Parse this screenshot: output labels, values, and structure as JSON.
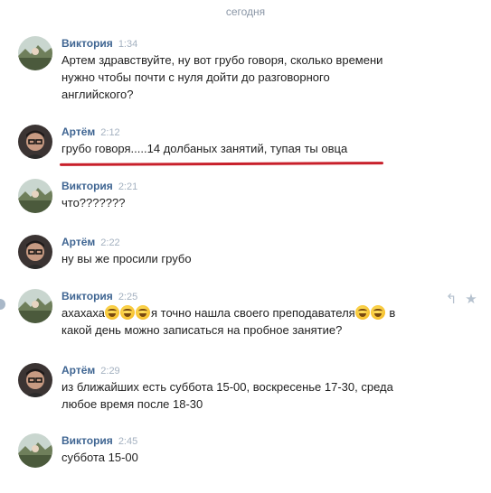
{
  "date_separator": "сегодня",
  "messages": [
    {
      "author": "Виктория",
      "time": "1:34",
      "lines": [
        "Артем здравствуйте, ну вот грубо говоря, сколько времени",
        "нужно чтобы почти с нуля дойти до разговорного",
        "английского?"
      ]
    },
    {
      "author": "Артём",
      "time": "2:12",
      "lines": [
        "грубо говоря.....14 долбаных занятий, тупая ты овца"
      ]
    },
    {
      "author": "Виктория",
      "time": "2:21",
      "lines": [
        "что???????"
      ]
    },
    {
      "author": "Артём",
      "time": "2:22",
      "lines": [
        "ну вы же просили грубо"
      ]
    },
    {
      "author": "Виктория",
      "time": "2:25",
      "line1_a": "ахахаха",
      "line1_b": "я точно нашла своего преподавателя",
      "line1_c": " в",
      "line2": "какой день можно записаться на пробное занятие?",
      "emoji_icon": "laughing-face-emoji"
    },
    {
      "author": "Артём",
      "time": "2:29",
      "lines": [
        "из ближайших есть суббота 15-00, воскресенье 17-30, среда",
        "любое время после 18-30"
      ]
    },
    {
      "author": "Виктория",
      "time": "2:45",
      "lines": [
        "суббота 15-00"
      ]
    }
  ],
  "actions": {
    "reply_icon": "↰",
    "star_icon": "★"
  },
  "colors": {
    "author": "#3f6592",
    "time": "#a4b1c0",
    "text": "#1f1f1f",
    "highlight_underline": "#c8202b",
    "date_separator": "#8a96a6"
  }
}
